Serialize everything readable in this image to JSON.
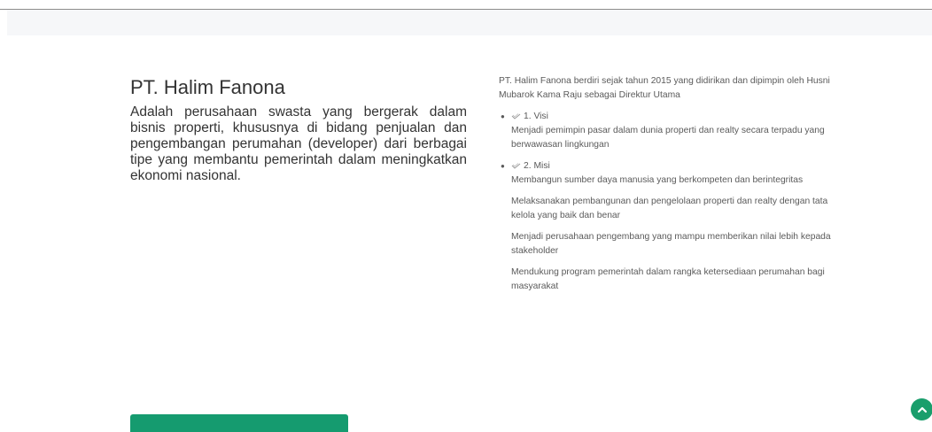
{
  "company": {
    "name": "PT. Halim Fanona",
    "description": "Adalah perusahaan swasta yang bergerak dalam bisnis properti, khususnya di bidang penjualan dan pengembangan perumahan (developer) dari berbagai tipe yang membantu pemerintah dalam meningkatkan ekonomi nasional."
  },
  "about": {
    "lead": "PT. Halim Fanona berdiri sejak tahun 2015 yang didirikan dan dipimpin oleh Husni Mubarok Kama Raju sebagai Direktur Utama",
    "visi": {
      "title": "1. Visi",
      "body": "Menjadi pemimpin pasar dalam dunia properti dan realty secara terpadu yang berwawasan lingkungan"
    },
    "misi": {
      "title": "2. Misi",
      "points": [
        "Membangun sumber daya manusia yang berkompeten dan berintegritas",
        "Melaksanakan pembangunan dan pengelolaan properti dan realty dengan tata kelola yang baik dan benar",
        "Menjadi perusahaan pengembang yang mampu memberikan nilai lebih kepada stakeholder",
        "Mendukung program pemerintah dalam rangka ketersediaan perumahan bagi masyarakat"
      ]
    },
    "item_icon": "wing-checkmark-icon"
  },
  "colors": {
    "accent_green": "#159b6f",
    "scroll_button": "#1a9e6c",
    "band": "#f6f7f9"
  },
  "icons": {
    "scroll_top": "chevron-up-icon"
  }
}
